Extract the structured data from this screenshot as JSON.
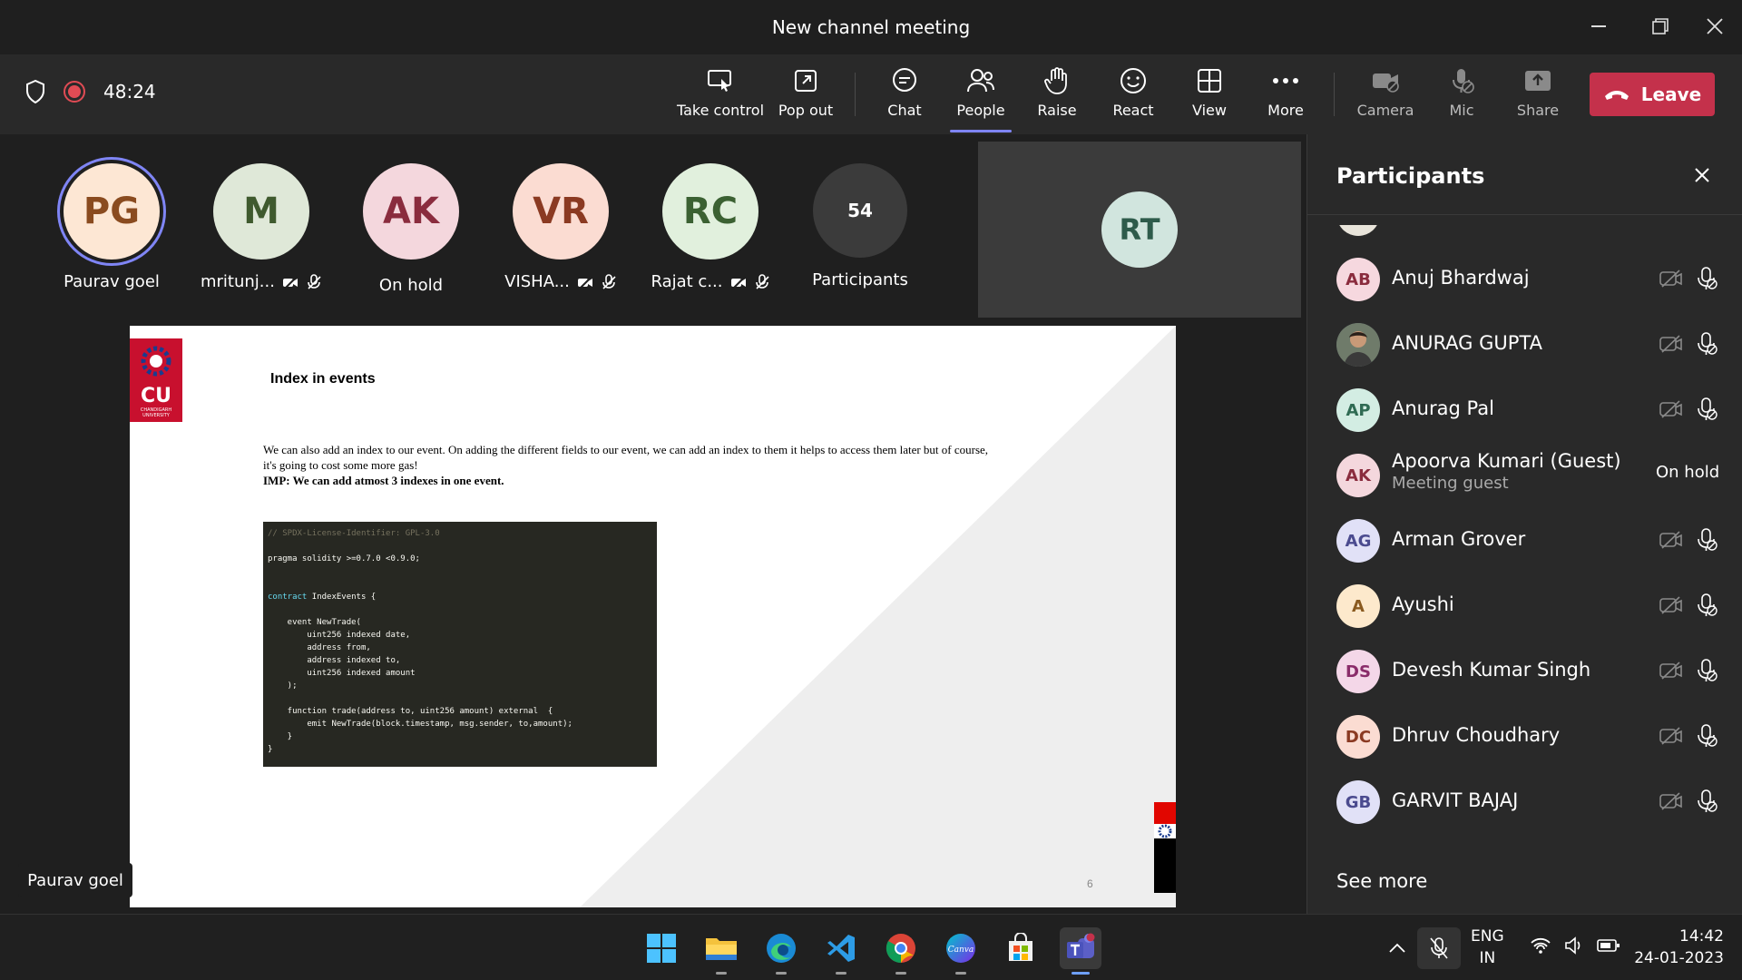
{
  "window": {
    "title": "New channel meeting",
    "minimize": "—",
    "restore": "❐",
    "close": "✕"
  },
  "toolbar": {
    "timer": "48:24",
    "buttons": {
      "take_control": "Take control",
      "pop_out": "Pop out",
      "chat": "Chat",
      "people": "People",
      "raise": "Raise",
      "react": "React",
      "view": "View",
      "more": "More",
      "camera": "Camera",
      "mic": "Mic",
      "share": "Share"
    },
    "leave": "Leave"
  },
  "gallery": {
    "tiles": [
      {
        "initials": "PG",
        "name": "Paurav goel",
        "bg": "#fde7d4",
        "fg": "#8a4b1f"
      },
      {
        "initials": "M",
        "name": "mritunj...",
        "bg": "#dfe8d8",
        "fg": "#3f5a2e"
      },
      {
        "initials": "AK",
        "name": "On hold",
        "bg": "#f4d7dd",
        "fg": "#8a2c3e"
      },
      {
        "initials": "VR",
        "name": "VISHA...",
        "bg": "#fbdcd2",
        "fg": "#8b3a22"
      },
      {
        "initials": "RC",
        "name": "Rajat c...",
        "bg": "#e1f0dd",
        "fg": "#3b6132"
      },
      {
        "initials": "54",
        "name": "Participants",
        "bg": "#3b3b3b",
        "fg": "#ffffff"
      }
    ],
    "spotlight": {
      "initials": "RT"
    },
    "speaker_label": "Paurav goel"
  },
  "slide": {
    "logo_text": "CU",
    "logo_sub": "CHANDIGARH UNIVERSITY",
    "title": "Index in events",
    "body": "We can also add an index to our event. On adding the different fields to our event, we can add an index to them it helps to access them later but of course, it's going to cost some more gas!",
    "imp": "IMP: We can add atmost 3 indexes in one event.",
    "code": {
      "comment": "// SPDX-License-Identifier: GPL-3.0",
      "pragma": "pragma solidity >=0.7.0 <0.9.0;",
      "contract_kw": "contract",
      "contract_rest": " IndexEvents {",
      "lines": [
        "    event NewTrade(",
        "        uint256 indexed date,",
        "        address from,",
        "        address indexed to,",
        "        uint256 indexed amount",
        "    );",
        "",
        "    function trade(address to, uint256 amount) external  {",
        "        emit NewTrade(block.timestamp, msg.sender, to,amount);",
        "    }",
        "}"
      ]
    },
    "page_number": "6"
  },
  "participants_panel": {
    "title": "Participants",
    "people": [
      {
        "initials": "AB",
        "name": "Anuj Bhardwaj",
        "bg": "#f6d8df",
        "fg": "#8a2c3e"
      },
      {
        "initials": "",
        "name": "ANURAG GUPTA",
        "bg": "#5b6b74",
        "fg": "#ffffff",
        "photo": true
      },
      {
        "initials": "AP",
        "name": "Anurag Pal",
        "bg": "#d3ede3",
        "fg": "#2f6b53"
      },
      {
        "initials": "AK",
        "name": "Apoorva Kumari (Guest)",
        "sub": "Meeting guest",
        "status": "On hold",
        "bg": "#f4d7dd",
        "fg": "#8a2c3e"
      },
      {
        "initials": "AG",
        "name": "Arman Grover",
        "bg": "#e1e1f7",
        "fg": "#4b4b8f"
      },
      {
        "initials": "A",
        "name": "Ayushi",
        "bg": "#fde9cc",
        "fg": "#8a5a1f"
      },
      {
        "initials": "DS",
        "name": "Devesh Kumar Singh",
        "bg": "#f4d7e8",
        "fg": "#8a2c6a"
      },
      {
        "initials": "DC",
        "name": "Dhruv Choudhary",
        "bg": "#fbdcd2",
        "fg": "#8b3a22"
      },
      {
        "initials": "GB",
        "name": "GARVIT BAJAJ",
        "bg": "#e1e1f7",
        "fg": "#4b4b8f"
      }
    ],
    "see_more": "See more"
  },
  "taskbar": {
    "apps": [
      "windows-start",
      "file-explorer",
      "edge",
      "vscode",
      "chrome",
      "canva",
      "microsoft-store",
      "teams"
    ],
    "canva_label": "Canva",
    "lang_top": "ENG",
    "lang_bottom": "IN",
    "time": "14:42",
    "date": "24-01-2023"
  },
  "colors": {
    "accent": "#7f85f5",
    "leave": "#c4314b",
    "record": "#e04b54"
  }
}
